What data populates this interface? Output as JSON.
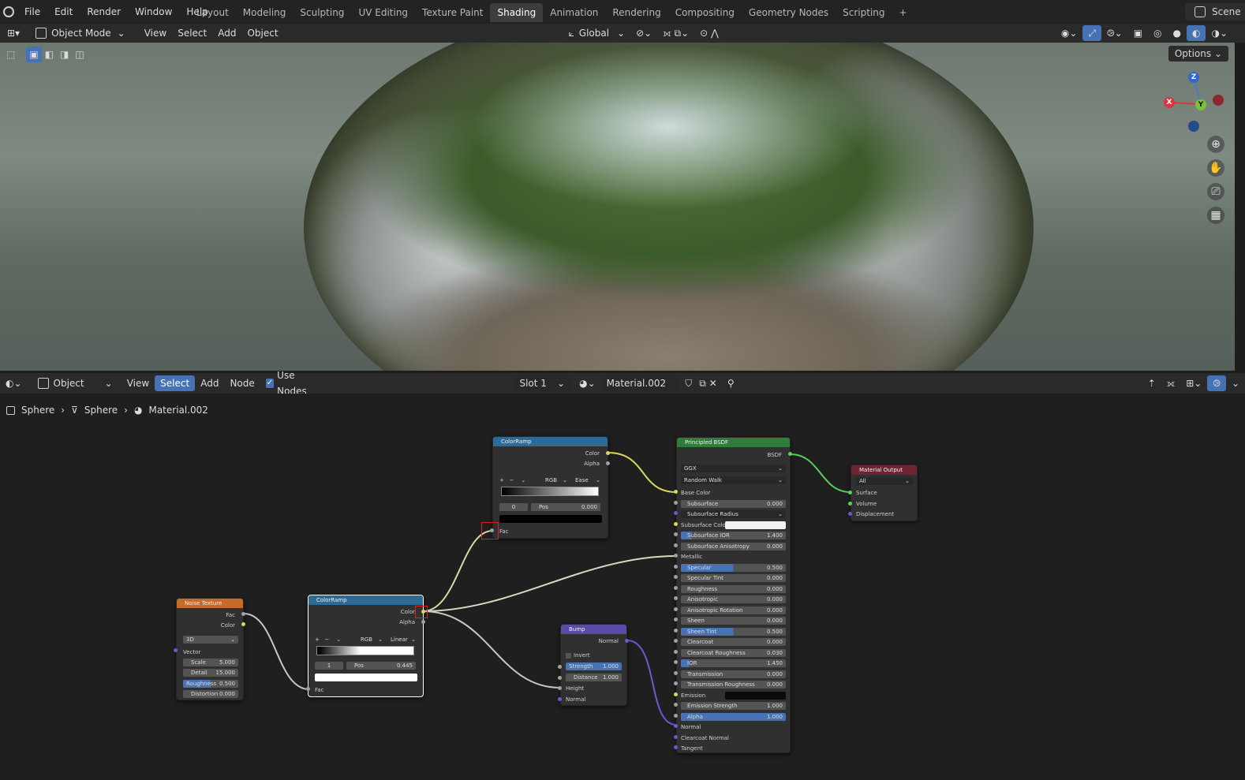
{
  "menu": [
    "File",
    "Edit",
    "Render",
    "Window",
    "Help"
  ],
  "workspaces": [
    "Layout",
    "Modeling",
    "Sculpting",
    "UV Editing",
    "Texture Paint",
    "Shading",
    "Animation",
    "Rendering",
    "Compositing",
    "Geometry Nodes",
    "Scripting"
  ],
  "active_workspace": "Shading",
  "scene_label": "Scene",
  "viewport_header": {
    "mode": "Object Mode",
    "menus": [
      "View",
      "Select",
      "Add",
      "Object"
    ],
    "orientation": "Global",
    "options": "Options"
  },
  "gizmo": {
    "z": "Z",
    "y": "Y",
    "x": "X"
  },
  "node_editor_header": {
    "editor_type": "Object",
    "menus": [
      "View",
      "Select",
      "Add",
      "Node"
    ],
    "active_menu": "Select",
    "use_nodes": "Use Nodes",
    "slot": "Slot 1",
    "material": "Material.002"
  },
  "breadcrumb": [
    "Sphere",
    "Sphere",
    "Material.002"
  ],
  "nodes": {
    "noise": {
      "title": "Noise Texture",
      "outputs": [
        "Fac",
        "Color"
      ],
      "dimension": "3D",
      "inputs": [
        "Vector"
      ],
      "fields": [
        {
          "label": "Scale",
          "value": "5.000"
        },
        {
          "label": "Detail",
          "value": "15.000"
        },
        {
          "label": "Roughness",
          "value": "0.500"
        },
        {
          "label": "Distortion",
          "value": "0.000"
        }
      ]
    },
    "ramp1": {
      "title": "ColorRamp",
      "outputs": [
        "Color",
        "Alpha"
      ],
      "mode": "RGB",
      "interp": "Linear",
      "index": "1",
      "pos_label": "Pos",
      "pos": "0.445",
      "input": "Fac"
    },
    "ramp2": {
      "title": "ColorRamp",
      "outputs": [
        "Color",
        "Alpha"
      ],
      "mode": "RGB",
      "interp": "Ease",
      "index": "0",
      "pos_label": "Pos",
      "pos": "0.000",
      "input": "Fac"
    },
    "bump": {
      "title": "Bump",
      "output": "Normal",
      "invert": "Invert",
      "fields": [
        {
          "label": "Strength",
          "value": "1.000"
        },
        {
          "label": "Distance",
          "value": "1.000"
        }
      ],
      "inputs": [
        "Height",
        "Normal"
      ]
    },
    "bsdf": {
      "title": "Principled BSDF",
      "output": "BSDF",
      "distribution": "GGX",
      "subsurface_method": "Random Walk",
      "rows": [
        {
          "label": "Base Color",
          "kind": "socket"
        },
        {
          "label": "Subsurface",
          "value": "0.000",
          "kind": "field"
        },
        {
          "label": "Subsurface Radius",
          "kind": "dropdown"
        },
        {
          "label": "Subsurface Colo",
          "kind": "color"
        },
        {
          "label": "Subsurface IOR",
          "value": "1.400",
          "kind": "field",
          "fill": 0.1
        },
        {
          "label": "Subsurface Anisotropy",
          "value": "0.000",
          "kind": "field"
        },
        {
          "label": "Metallic",
          "kind": "socket"
        },
        {
          "label": "Specular",
          "value": "0.500",
          "kind": "field",
          "fill": 0.5
        },
        {
          "label": "Specular Tint",
          "value": "0.000",
          "kind": "field"
        },
        {
          "label": "Roughness",
          "value": "0.000",
          "kind": "field"
        },
        {
          "label": "Anisotropic",
          "value": "0.000",
          "kind": "field"
        },
        {
          "label": "Anisotropic Rotation",
          "value": "0.000",
          "kind": "field"
        },
        {
          "label": "Sheen",
          "value": "0.000",
          "kind": "field"
        },
        {
          "label": "Sheen Tint",
          "value": "0.500",
          "kind": "field",
          "fill": 0.5
        },
        {
          "label": "Clearcoat",
          "value": "0.000",
          "kind": "field"
        },
        {
          "label": "Clearcoat Roughness",
          "value": "0.030",
          "kind": "field"
        },
        {
          "label": "IOR",
          "value": "1.450",
          "kind": "field",
          "fill": 0.08
        },
        {
          "label": "Transmission",
          "value": "0.000",
          "kind": "field"
        },
        {
          "label": "Transmission Roughness",
          "value": "0.000",
          "kind": "field"
        },
        {
          "label": "Emission",
          "kind": "color-dark"
        },
        {
          "label": "Emission Strength",
          "value": "1.000",
          "kind": "field"
        },
        {
          "label": "Alpha",
          "value": "1.000",
          "kind": "field",
          "fill": 1.0
        },
        {
          "label": "Normal",
          "kind": "socket"
        },
        {
          "label": "Clearcoat Normal",
          "kind": "socket"
        },
        {
          "label": "Tangent",
          "kind": "socket"
        }
      ]
    },
    "output": {
      "title": "Material Output",
      "target": "All",
      "inputs": [
        "Surface",
        "Volume",
        "Displacement"
      ]
    }
  },
  "colors": {
    "header_input": "#83314a",
    "header_texture": "#c66a2a",
    "header_converter": "#2d6b96",
    "header_shader": "#2f7d3b",
    "header_vector": "#5a4ba8",
    "header_output": "#6e2533",
    "wire_color": "#d8d860",
    "wire_float": "#c8c8c8",
    "wire_shader": "#5ad05a",
    "wire_vector": "#6a5ad0"
  }
}
